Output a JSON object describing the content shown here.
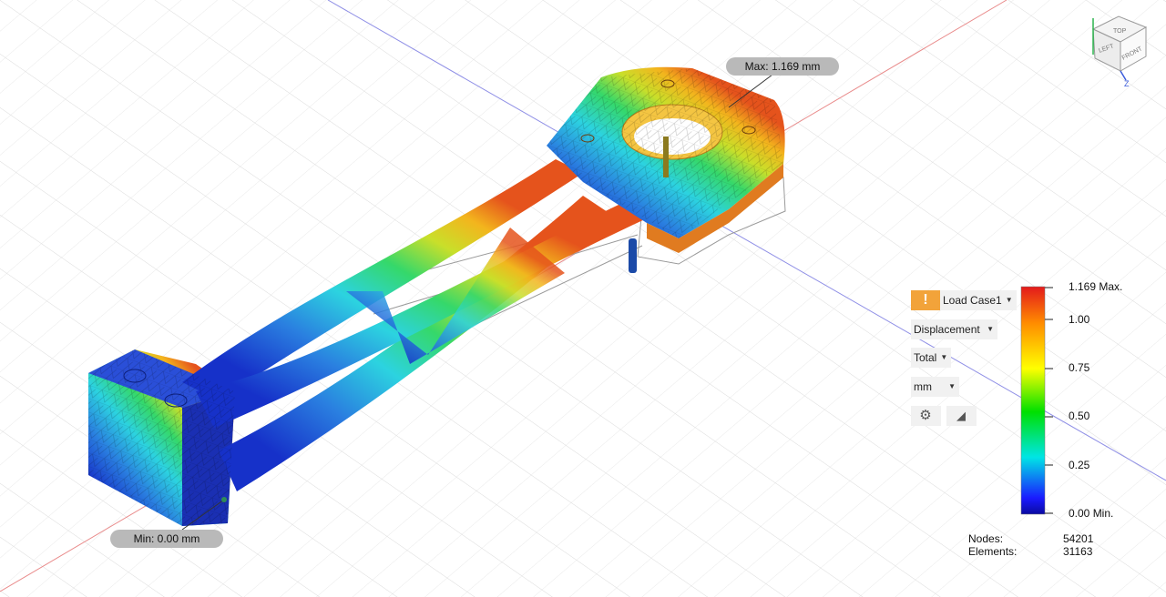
{
  "viewcube": {
    "top": "TOP",
    "left": "LEFT",
    "front": "FRONT",
    "axis_z": "Z"
  },
  "callouts": {
    "max": "Max: 1.169 mm",
    "min": "Min: 0.00 mm"
  },
  "results_panel": {
    "load_case": "Load Case1",
    "result_type": "Displacement",
    "component": "Total",
    "units": "mm",
    "settings_icon": "gear-icon",
    "probe_icon": "triangle-probe-icon",
    "warning_icon": "warning-icon"
  },
  "legend": {
    "ticks": [
      "1.169 Max.",
      "1.00",
      "0.75",
      "0.50",
      "0.25",
      "0.00 Min."
    ],
    "colors": [
      "#e31a1c",
      "#ff8c00",
      "#ffff00",
      "#00e000",
      "#00e5e5",
      "#1a1aff",
      "#0a0aa0"
    ]
  },
  "stats": {
    "nodes_label": "Nodes:",
    "nodes_value": "54201",
    "elements_label": "Elements:",
    "elements_value": "31163"
  }
}
